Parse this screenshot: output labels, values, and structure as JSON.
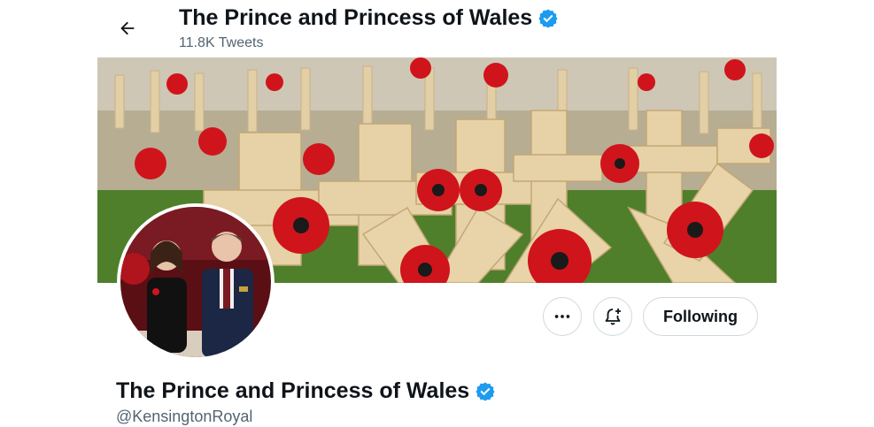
{
  "header": {
    "title": "The Prince and Princess of Wales",
    "tweet_count": "11.8K Tweets",
    "back_icon": "arrow-left-icon"
  },
  "banner": {
    "description_icon": "poppy-crosses-banner"
  },
  "actions": {
    "more_icon": "ellipsis-icon",
    "notify_icon": "bell-plus-icon",
    "following_label": "Following"
  },
  "profile": {
    "display_name": "The Prince and Princess of Wales",
    "handle": "@KensingtonRoyal"
  },
  "colors": {
    "verified": "#1d9bf0",
    "text": "#0f1419",
    "secondary_text": "#536471",
    "border": "#cfd9de",
    "poppy_red": "#d0141c"
  }
}
